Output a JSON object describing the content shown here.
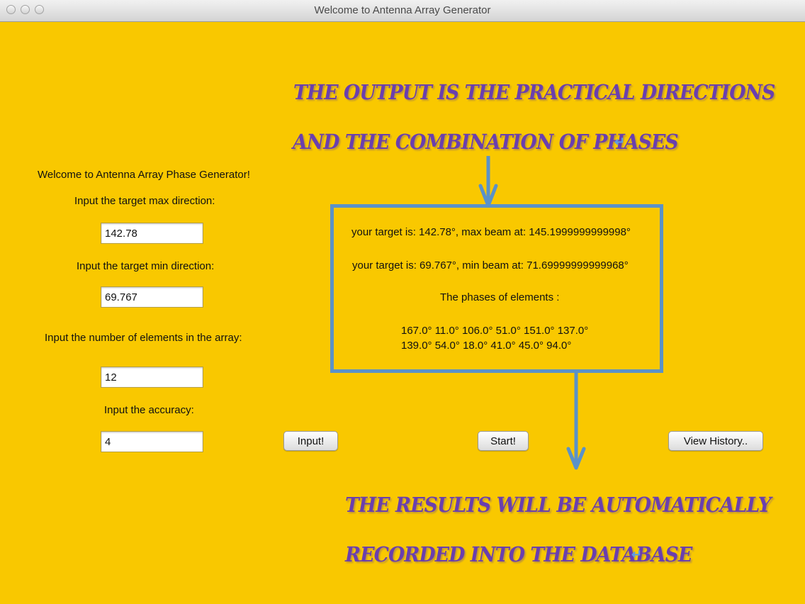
{
  "window": {
    "title": "Welcome to Antenna Array Generator"
  },
  "form": {
    "welcome": "Welcome to Antenna Array Phase Generator!",
    "max_label": "Input the target max direction:",
    "max_value": "142.78",
    "min_label": "Input the target min direction:",
    "min_value": "69.767",
    "elements_label": "Input the number of elements in the array:",
    "elements_value": "12",
    "accuracy_label": "Input the accuracy:",
    "accuracy_value": "4"
  },
  "buttons": {
    "input": "Input!",
    "start": "Start!",
    "history": "View History.."
  },
  "output": {
    "max_line": "your target is: 142.78°, max beam at: 145.1999999999998°",
    "min_line": "your target is: 69.767°, min beam at: 71.69999999999968°",
    "phases_heading": "The phases of elements :",
    "phases_line1": "167.0° 11.0° 106.0° 51.0° 151.0° 137.0°",
    "phases_line2": "139.0° 54.0° 18.0° 41.0° 45.0° 94.0°"
  },
  "annotations": {
    "top_line1": "THE  OUTPUT  IS  THE  PRACTICAL  DIRECTIONS",
    "top_line2": "AND THE COMBINATION OF PHASES",
    "bottom_line1": "THE    RESULTS    WILL    BE    AUTOMATICALLY",
    "bottom_line2": "RECORDED INTO THE DATABASE",
    "return_mark": "↵"
  },
  "colors": {
    "background": "#f9c800",
    "annotation_text": "#6a3fae",
    "arrow": "#5b92c8"
  }
}
